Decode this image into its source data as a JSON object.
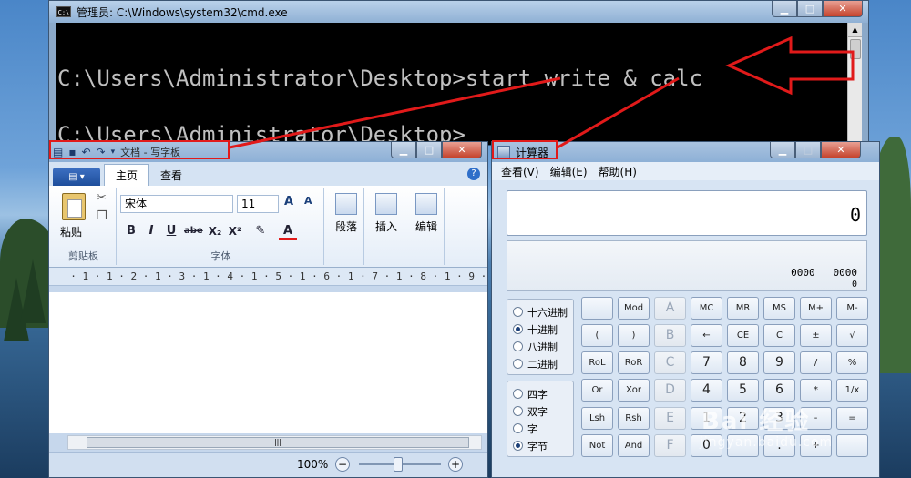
{
  "cmd": {
    "title": "管理员: C:\\Windows\\system32\\cmd.exe",
    "line1": "C:\\Users\\Administrator\\Desktop>start write & calc",
    "line2": "C:\\Users\\Administrator\\Desktop>",
    "icon_text": "C:\\"
  },
  "wordpad": {
    "title": "文档 - 写字板",
    "tabs": [
      "主页",
      "查看"
    ],
    "paste_label": "粘贴",
    "clipboard_group": "剪贴板",
    "font_name": "宋体",
    "font_size": "11",
    "font_group": "字体",
    "paragraph_label": "段落",
    "insert_label": "插入",
    "edit_label": "编辑",
    "format_buttons": [
      "B",
      "I",
      "U",
      "abe",
      "X₂",
      "X²"
    ],
    "ruler": "  · 1 · 1 · 2 · 1 · 3 · 1 · 4 · 1 · 5 · 1 · 6 · 1 · 7 · 1 · 8 · 1 · 9 · 1 ·10· 1 ·11· 1",
    "zoom": "100%",
    "scroll_grip": "|||"
  },
  "calc": {
    "title": "计算器",
    "menu": [
      "查看(V)",
      "编辑(E)",
      "帮助(H)"
    ],
    "display": "0",
    "bits_line1": "0000   0000",
    "bits_line2": "0",
    "radix_options": [
      "十六进制",
      "十进制",
      "八进制",
      "二进制"
    ],
    "radix_selected": 1,
    "word_options": [
      "四字",
      "双字",
      "字",
      "字节"
    ],
    "word_selected": 3,
    "buttons": [
      [
        "",
        "Mod",
        "A",
        "MC",
        "MR",
        "MS",
        "M+",
        "M-"
      ],
      [
        "(",
        ")",
        "B",
        "←",
        "CE",
        "C",
        "±",
        "√"
      ],
      [
        "RoL",
        "RoR",
        "C",
        "7",
        "8",
        "9",
        "/",
        "%"
      ],
      [
        "Or",
        "Xor",
        "D",
        "4",
        "5",
        "6",
        "*",
        "1/x"
      ],
      [
        "Lsh",
        "Rsh",
        "E",
        "1",
        "2",
        "3",
        "-",
        "="
      ],
      [
        "Not",
        "And",
        "F",
        "0",
        "",
        ".",
        "+",
        ""
      ]
    ]
  },
  "watermark": {
    "brand": "Bai 经验",
    "url": "jingyan.baidu.com"
  }
}
